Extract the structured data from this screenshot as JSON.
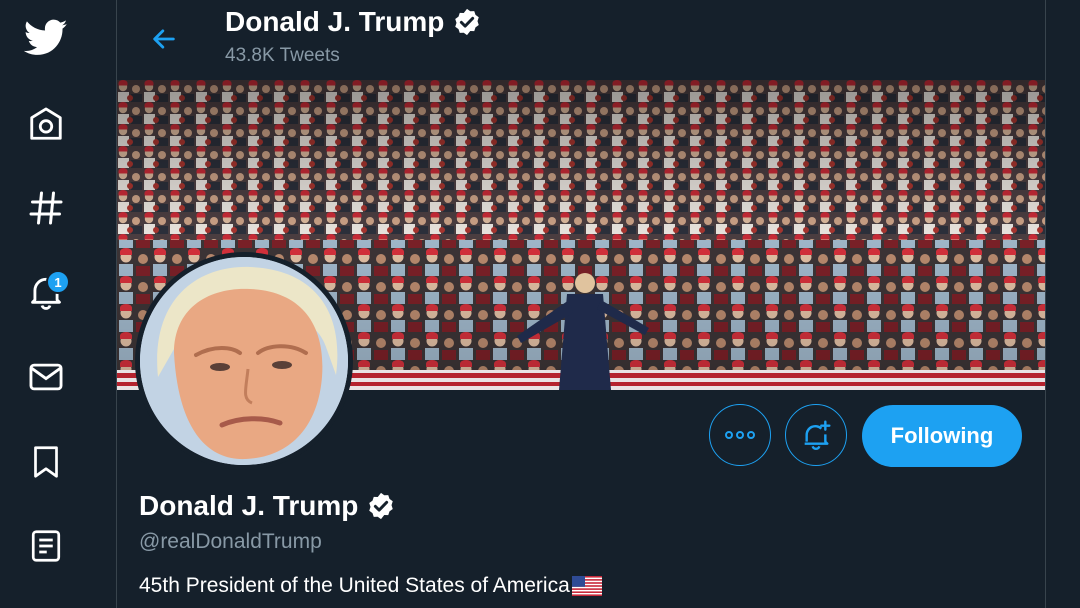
{
  "header": {
    "name": "Donald J. Trump",
    "tweet_count": "43.8K Tweets"
  },
  "nav": {
    "items": [
      {
        "icon": "twitter-bird-icon"
      },
      {
        "icon": "home-icon"
      },
      {
        "icon": "explore-hashtag-icon"
      },
      {
        "icon": "notifications-bell-icon",
        "badge": "1"
      },
      {
        "icon": "messages-envelope-icon"
      },
      {
        "icon": "bookmark-icon"
      },
      {
        "icon": "lists-icon"
      }
    ]
  },
  "profile": {
    "display_name": "Donald J. Trump",
    "handle": "@realDonaldTrump",
    "bio": "45th President of the United States of America",
    "verified": true
  },
  "actions": {
    "more_icon": "more-dots-icon",
    "notify_icon": "bell-plus-icon",
    "follow_label": "Following"
  },
  "colors": {
    "background": "#15202b",
    "accent": "#1da1f2",
    "secondary_text": "#8899a6",
    "border": "#38444d"
  }
}
